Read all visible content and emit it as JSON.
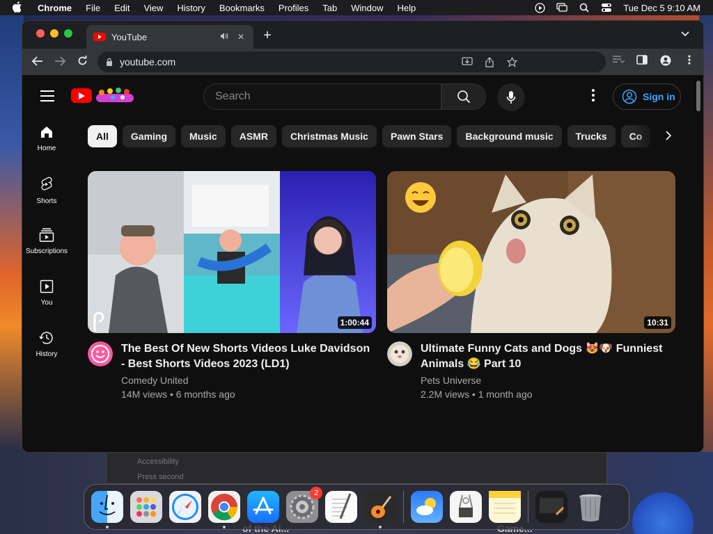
{
  "menubar": {
    "app_name": "Chrome",
    "items": [
      "File",
      "Edit",
      "View",
      "History",
      "Bookmarks",
      "Profiles",
      "Tab",
      "Window",
      "Help"
    ],
    "datetime": "Tue Dec 5  9:10 AM"
  },
  "browser": {
    "tab_title": "YouTube",
    "url": "youtube.com"
  },
  "youtube": {
    "search_placeholder": "Search",
    "signin_label": "Sign in",
    "sidebar": [
      {
        "label": "Home"
      },
      {
        "label": "Shorts"
      },
      {
        "label": "Subscriptions"
      },
      {
        "label": "You"
      },
      {
        "label": "History"
      }
    ],
    "chips": [
      "All",
      "Gaming",
      "Music",
      "ASMR",
      "Christmas Music",
      "Pawn Stars",
      "Background music",
      "Trucks",
      "Co"
    ],
    "videos": [
      {
        "title": "The Best Of New Shorts Videos Luke Davidson - Best Shorts Videos 2023 (LD1)",
        "channel": "Comedy United",
        "stats": "14M views • 6 months ago",
        "duration": "1:00:44"
      },
      {
        "title": "Ultimate Funny Cats and Dogs 😻🐶 Funniest Animals 😂 Part 10",
        "channel": "Pets Universe",
        "stats": "2.2M views • 1 month ago",
        "duration": "10:31"
      }
    ]
  },
  "background": {
    "ghost_lines": [
      "Accessibility",
      "Press second"
    ],
    "captions": [
      "of the Al...",
      "Game..."
    ]
  },
  "dock": {
    "settings_badge": "2"
  },
  "colors": {
    "youtube_red": "#ff0000",
    "link_blue": "#3ea6ff",
    "page_bg": "#0f0f0f"
  }
}
